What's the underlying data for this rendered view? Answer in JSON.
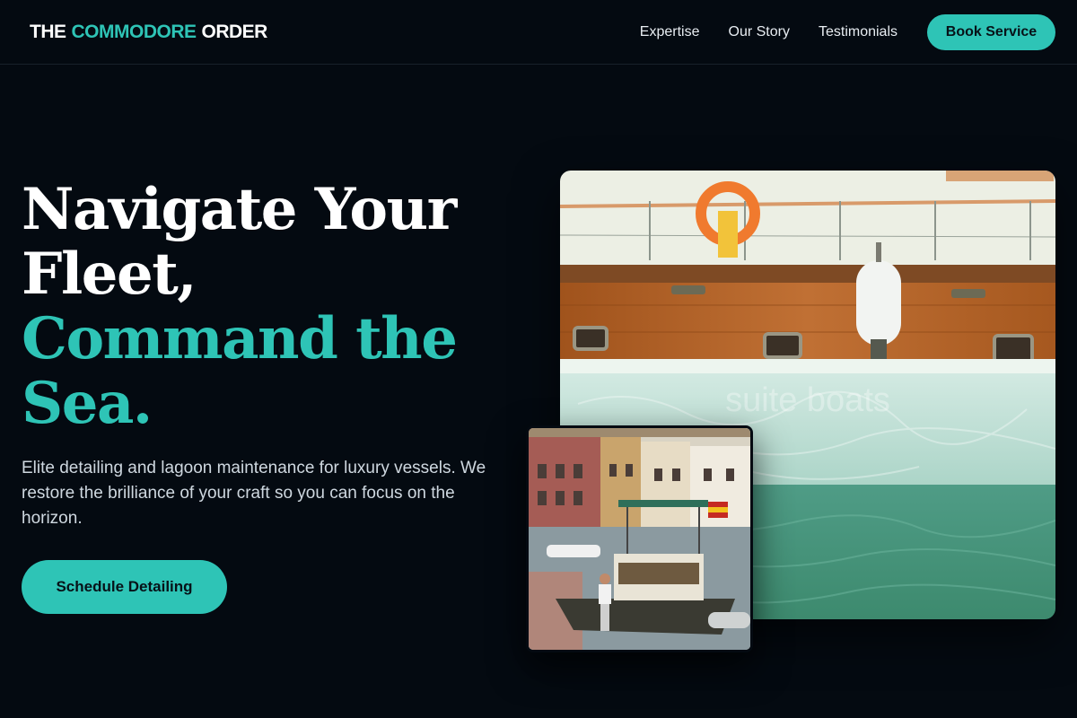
{
  "header": {
    "brand_part1": "THE",
    "brand_part2": "COMMODORE",
    "brand_part3": "ORDER",
    "nav": [
      "Expertise",
      "Our Story",
      "Testimonials"
    ],
    "cta": "Book Service"
  },
  "hero": {
    "title_line1": "Navigate Your",
    "title_line2": "Fleet,",
    "title_line3": "Command the",
    "title_line4": "Sea.",
    "description": "Elite detailing and lagoon maintenance for luxury vessels. We restore the brilliance of your craft so you can focus on the horizon.",
    "cta": "Schedule Detailing"
  },
  "images": {
    "main_watermark": "suite boats"
  },
  "colors": {
    "accent": "#2ec4b6",
    "background": "#040a11"
  }
}
